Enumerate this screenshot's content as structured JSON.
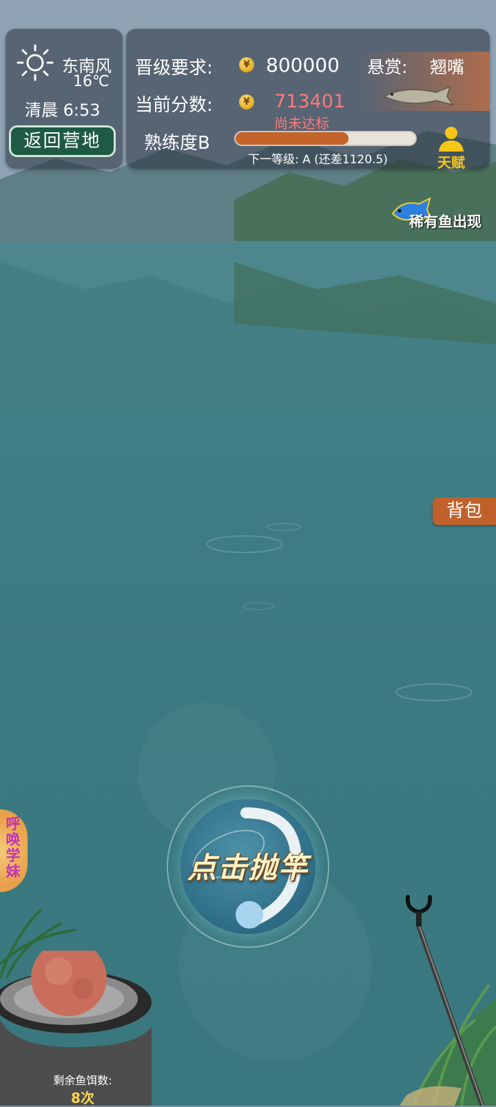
{
  "weather": {
    "wind": "东南风",
    "temperature": "16℃",
    "time_of_day": "清晨 6:53",
    "return_button": "返回营地"
  },
  "score": {
    "promotion_label": "晋级要求:",
    "promotion_value": "800000",
    "current_label": "当前分数:",
    "current_value": "713401",
    "status": "尚未达标",
    "coin_glyph": "¥"
  },
  "bounty": {
    "label": "悬赏:",
    "fish": "翘嘴"
  },
  "proficiency": {
    "label": "熟练度B",
    "progress_fraction": 0.63,
    "next_level": "下一等级: A (还差1120.5)"
  },
  "talent": {
    "label": "天赋"
  },
  "rare_fish": {
    "label": "稀有鱼出现"
  },
  "bag": {
    "label": "背包"
  },
  "cast": {
    "label": "点击抛竿"
  },
  "summon": {
    "label": "呼唤学妹"
  },
  "bait": {
    "label": "剩余鱼饵数:",
    "count": "8次"
  },
  "colors": {
    "water": "#3b7a80",
    "progress": "#c4632a",
    "bag_button": "#c0612b",
    "return_button": "#1f5a44",
    "score_red": "#ff7a7a",
    "talent_yellow": "#f5c518"
  }
}
